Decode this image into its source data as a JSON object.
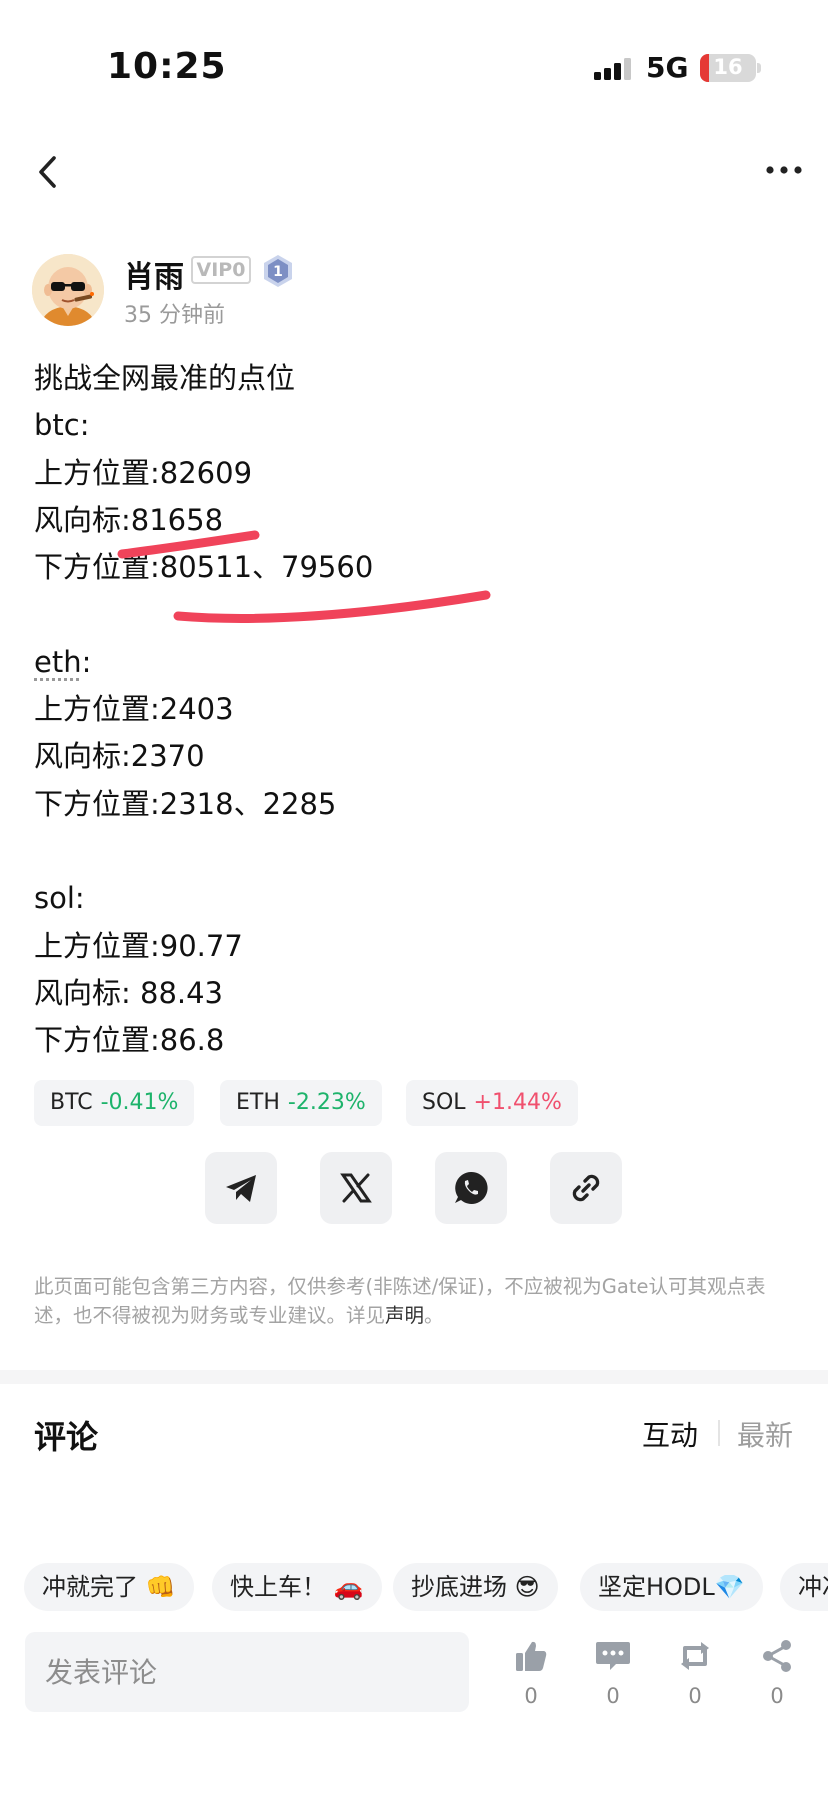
{
  "status_bar": {
    "time": "10:25",
    "network": "5G",
    "battery": "16"
  },
  "author": {
    "name": "肖雨",
    "vip": "VIP0",
    "level": "1",
    "time_ago": "35 分钟前"
  },
  "post": {
    "title": "挑战全网最准的点位",
    "btc": {
      "label": "btc:",
      "upper": "上方位置:82609",
      "vane": "风向标:81658",
      "lower": "下方位置:80511、79560"
    },
    "eth": {
      "label_word": "eth",
      "label_colon": ":",
      "upper": "上方位置:2403",
      "vane": "风向标:2370",
      "lower": "下方位置:2318、2285"
    },
    "sol": {
      "label": "sol:",
      "upper": "上方位置:90.77",
      "vane": "风向标: 88.43",
      "lower": "下方位置:86.8"
    }
  },
  "tickers": [
    {
      "symbol": "BTC",
      "change": "-0.41%",
      "color": "#1db36b"
    },
    {
      "symbol": "ETH",
      "change": "-2.23%",
      "color": "#1db36b"
    },
    {
      "symbol": "SOL",
      "change": "+1.44%",
      "color": "#f0506e"
    }
  ],
  "share_icons": [
    "telegram-icon",
    "x-icon",
    "whatsapp-icon",
    "link-icon"
  ],
  "disclaimer": {
    "text": "此页面可能包含第三方内容，仅供参考(非陈述/保证)，不应被视为Gate认可其观点表述，也不得被视为财务或专业建议。详见",
    "link": "声明",
    "end": "。"
  },
  "comments": {
    "title": "评论",
    "tab_hot": "互动",
    "tab_new": "最新"
  },
  "quick_replies": [
    "冲就完了 👊",
    "快上车！ 🚗",
    "抄底进场 😎",
    "坚定HODL💎",
    "冲冲"
  ],
  "bottom_bar": {
    "placeholder": "发表评论",
    "like_count": "0",
    "comment_count": "0",
    "repost_count": "0",
    "share_count": "0"
  },
  "colors": {
    "annotation": "#f0435a",
    "negative": "#1db36b",
    "positive": "#f0506e"
  }
}
